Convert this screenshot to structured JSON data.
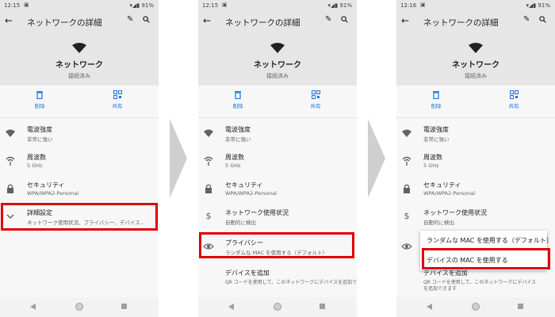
{
  "colors": {
    "accent": "#1a73e8",
    "highlight": "#e00000"
  },
  "phones": [
    {
      "status_time": "12:15",
      "status_right": "▾◢▮ 91%",
      "title": "ネットワークの詳細",
      "network_name": "ネットワーク",
      "network_status": "接続済み",
      "actions": [
        "削除",
        "共有"
      ],
      "rows": [
        {
          "title": "電波強度",
          "sub": "非常に強い",
          "icon": "signal-icon"
        },
        {
          "title": "周波数",
          "sub": "5 GHz",
          "icon": "frequency-icon"
        },
        {
          "title": "セキュリティ",
          "sub": "WPA/WPA2-Personal",
          "icon": "lock-icon"
        },
        {
          "title": "詳細設定",
          "sub": "ネットワーク使用状況、プライバシー、デバイス...",
          "icon": "chevron-down-icon"
        }
      ]
    },
    {
      "status_time": "12:15",
      "status_right": "▾◢▮ 91%",
      "title": "ネットワークの詳細",
      "network_name": "ネットワーク",
      "network_status": "接続済み",
      "actions": [
        "削除",
        "共有"
      ],
      "rows": [
        {
          "title": "電波強度",
          "sub": "非常に強い",
          "icon": "signal-icon"
        },
        {
          "title": "周波数",
          "sub": "5 GHz",
          "icon": "frequency-icon"
        },
        {
          "title": "セキュリティ",
          "sub": "WPA/WPA2-Personal",
          "icon": "lock-icon"
        },
        {
          "title": "ネットワーク使用状況",
          "sub": "自動的に検出",
          "icon": "dollar-icon"
        },
        {
          "title": "プライバシー",
          "sub": "ランダムな MAC を使用する（デフォルト）",
          "icon": "privacy-eye-icon"
        },
        {
          "title": "デバイスを追加",
          "sub": "QR コードを使用して、このネットワークにデバイスを追加できます",
          "sub2": "を追加できます",
          "icon": "none"
        }
      ]
    },
    {
      "status_time": "12:16",
      "status_right": "▾◢▮ 91%",
      "title": "ネットワークの詳細",
      "network_name": "ネットワーク",
      "network_status": "接続済み",
      "actions": [
        "削除",
        "共有"
      ],
      "rows": [
        {
          "title": "電波強度",
          "sub": "非常に強い",
          "icon": "signal-icon"
        },
        {
          "title": "周波数",
          "sub": "5 GHz",
          "icon": "frequency-icon"
        },
        {
          "title": "セキュリティ",
          "sub": "WPA/WPA2-Personal",
          "icon": "lock-icon"
        },
        {
          "title": "ネットワーク使用状況",
          "sub": "自動的に検出",
          "icon": "dollar-icon"
        },
        {
          "title": "プライバシー",
          "sub": "",
          "icon": "privacy-eye-icon"
        },
        {
          "title": "デバイスを追加",
          "sub": "QR コードを使用して、このネットワークにデバイス",
          "sub2": "を追加できます",
          "icon": "none"
        }
      ],
      "privacy_menu": [
        "ランダムな MAC を使用する（デフォルト）",
        "デバイスの MAC を使用する"
      ]
    }
  ]
}
